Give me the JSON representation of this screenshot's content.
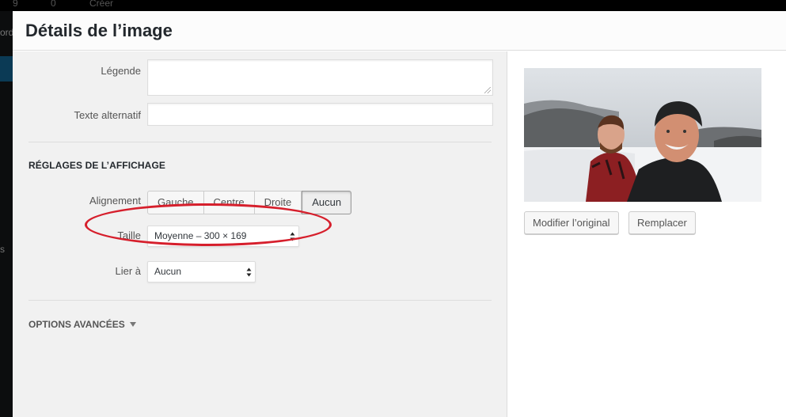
{
  "modal": {
    "title": "Détails de l’image"
  },
  "fields": {
    "caption_label": "Légende",
    "caption_value": "",
    "alt_label": "Texte alternatif",
    "alt_value": ""
  },
  "display": {
    "section_title": "RÉGLAGES DE L’AFFICHAGE",
    "alignment_label": "Alignement",
    "alignment_options": [
      "Gauche",
      "Centre",
      "Droite",
      "Aucun"
    ],
    "alignment_selected": "Aucun",
    "size_label": "Taille",
    "size_value": "Moyenne – 300 × 169",
    "link_label": "Lier à",
    "link_value": "Aucun"
  },
  "advanced": {
    "label": "OPTIONS AVANCÉES"
  },
  "preview": {
    "edit_original": "Modifier l’original",
    "replace": "Remplacer"
  },
  "background": {
    "adminbar_items": [
      "9",
      "0",
      "Créer"
    ],
    "side_fragments": [
      "ord",
      "s"
    ]
  },
  "colors": {
    "annotation": "#d61f2c",
    "title": "#23282d"
  },
  "icons": [
    "select-arrows-icon",
    "caret-down-icon",
    "resize-grip-icon"
  ]
}
